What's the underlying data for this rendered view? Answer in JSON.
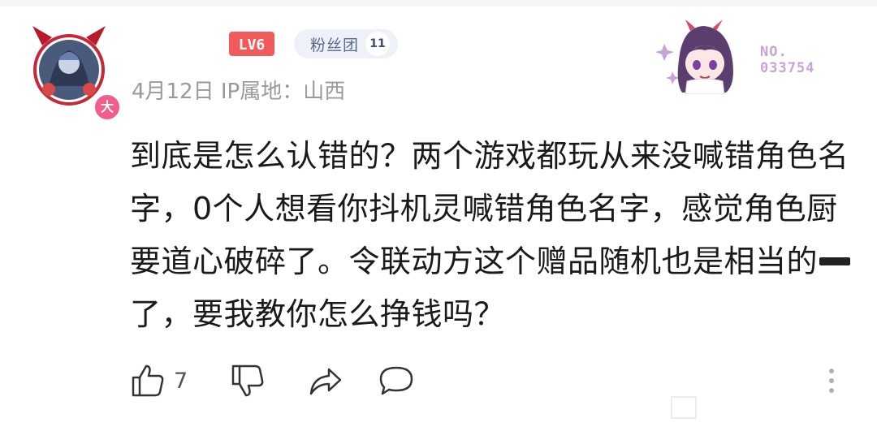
{
  "user": {
    "avatar_badge": "大",
    "level_text": "LV6",
    "fan_badge": {
      "label": "粉丝团",
      "level": "11"
    },
    "meta": "4月12日 IP属地：山西"
  },
  "decoration": {
    "number_line1": "NO.",
    "number_line2": "033754"
  },
  "comment": {
    "part1": "到底是怎么认错的？两个游戏都玩从来没喊错角色名字，0个人想看你抖机灵喊错角色名字，感觉角色厨要道心破碎了。令联动方这个赠品随机也是相当的",
    "part2": "了，要我教你怎么挣钱吗？"
  },
  "actions": {
    "like_count": "7"
  },
  "colors": {
    "badge_pink": "#f25d8e",
    "level_red": "#f05a5a",
    "fan_bg": "#eef1f8",
    "meta_gray": "#9a9a9a",
    "decor_purple": "#c8a3d6"
  }
}
